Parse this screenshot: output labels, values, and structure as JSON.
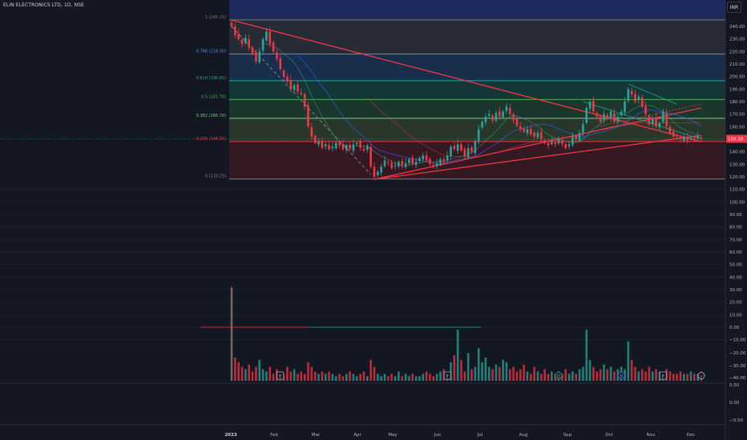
{
  "title": "ELIN ELECTRONICS LTD, 1D, NSE",
  "currency_button": "INR",
  "chart_data": {
    "type": "candlestick",
    "symbol": "ELIN ELECTRONICS LTD",
    "interval": "1D",
    "exchange": "NSE",
    "price_axis": {
      "range": [
        -10,
        250
      ],
      "ticks": [
        240,
        230,
        220,
        210,
        200,
        190,
        180,
        170,
        160,
        150,
        140,
        130,
        120,
        110,
        100,
        90,
        80,
        70,
        60,
        50,
        40,
        30,
        20,
        10,
        0,
        -10
      ],
      "tick_labels": [
        "240.00",
        "230.00",
        "220.00",
        "210.00",
        "200.00",
        "190.00",
        "180.00",
        "170.00",
        "160.00",
        "150.00",
        "140.00",
        "130.00",
        "120.00",
        "110.00",
        "100.00",
        "90.00",
        "80.00",
        "70.00",
        "60.00",
        "50.00",
        "40.00",
        "30.00",
        "20.00",
        "10.00",
        "0.00",
        "−10.00"
      ],
      "current_price": 150.3,
      "current_price_label": "150.30"
    },
    "oscillator_axis": {
      "ticks": [
        -20,
        -30,
        -40
      ],
      "tick_labels": [
        "−20.00",
        "−30.00",
        "−40.00"
      ]
    },
    "bottom_pane_axis": {
      "tick_labels": [
        "0.50",
        "0.00",
        "−0.50"
      ]
    },
    "x_axis": {
      "labels": [
        "2023",
        "Feb",
        "Mar",
        "Apr",
        "May",
        "Jun",
        "Jul",
        "Aug",
        "Sep",
        "Oct",
        "Nov",
        "Dec"
      ],
      "bold_label": "2023"
    },
    "fibonacci": {
      "levels": [
        {
          "ratio": "1",
          "price": 245.15,
          "label": "1 (245.15)",
          "color": "#787b86"
        },
        {
          "ratio": "0.786",
          "price": 218.0,
          "label": "0.786 (218.00)",
          "color": "#4c8fe8"
        },
        {
          "ratio": "0.618",
          "price": 196.65,
          "label": "0.618 (196.65)",
          "color": "#26a69a"
        },
        {
          "ratio": "0.5",
          "price": 181.7,
          "label": "0.5 (181.70)",
          "color": "#4caf50"
        },
        {
          "ratio": "0.382",
          "price": 166.7,
          "label": "0.382 (166.70)",
          "color": "#81c784"
        },
        {
          "ratio": "0.236",
          "price": 148.2,
          "label": "0.236 (148.20)",
          "color": "#f23645"
        },
        {
          "ratio": "0",
          "price": 118.25,
          "label": "0 (118.25)",
          "color": "#787b86"
        }
      ],
      "band_colors": [
        "#1e2a5c",
        "#2a2e39",
        "#1b3150",
        "#163a3a",
        "#1d3a2e",
        "#2b3b2a",
        "#3a1a22"
      ]
    },
    "series": [
      {
        "name": "",
        "type": "candlestick",
        "closes": [
          [
            0,
            240
          ],
          [
            1,
            233
          ],
          [
            2,
            230
          ],
          [
            3,
            226
          ],
          [
            4,
            231
          ],
          [
            5,
            223
          ],
          [
            6,
            218
          ],
          [
            7,
            212
          ],
          [
            8,
            220
          ],
          [
            9,
            230
          ],
          [
            10,
            236
          ],
          [
            11,
            226
          ],
          [
            12,
            220
          ],
          [
            13,
            214
          ],
          [
            14,
            206
          ],
          [
            15,
            200
          ],
          [
            16,
            196
          ],
          [
            17,
            190
          ],
          [
            18,
            193
          ],
          [
            19,
            188
          ],
          [
            20,
            186
          ],
          [
            21,
            176
          ],
          [
            22,
            160
          ],
          [
            23,
            152
          ],
          [
            24,
            147
          ],
          [
            25,
            148
          ],
          [
            26,
            143
          ],
          [
            27,
            146
          ],
          [
            28,
            142
          ],
          [
            29,
            144
          ],
          [
            30,
            147
          ],
          [
            31,
            145
          ],
          [
            32,
            142
          ],
          [
            33,
            145
          ],
          [
            34,
            142
          ],
          [
            35,
            146
          ],
          [
            36,
            147
          ],
          [
            37,
            143
          ],
          [
            38,
            141
          ],
          [
            39,
            145
          ],
          [
            40,
            128
          ],
          [
            41,
            120
          ],
          [
            42,
            124
          ],
          [
            43,
            128
          ],
          [
            44,
            133
          ],
          [
            45,
            131
          ],
          [
            46,
            127
          ],
          [
            47,
            129
          ],
          [
            48,
            132
          ],
          [
            49,
            129
          ],
          [
            50,
            131
          ],
          [
            51,
            134
          ],
          [
            52,
            130
          ],
          [
            53,
            132
          ],
          [
            54,
            135
          ],
          [
            55,
            137
          ],
          [
            56,
            133
          ],
          [
            57,
            130
          ],
          [
            58,
            128
          ],
          [
            59,
            131
          ],
          [
            60,
            134
          ],
          [
            61,
            132
          ],
          [
            62,
            137
          ],
          [
            63,
            144
          ],
          [
            64,
            142
          ],
          [
            65,
            146
          ],
          [
            66,
            141
          ],
          [
            67,
            136
          ],
          [
            68,
            143
          ],
          [
            69,
            140
          ],
          [
            70,
            148
          ],
          [
            71,
            158
          ],
          [
            72,
            164
          ],
          [
            73,
            168
          ],
          [
            74,
            170
          ],
          [
            75,
            165
          ],
          [
            76,
            171
          ],
          [
            77,
            168
          ],
          [
            78,
            172
          ],
          [
            79,
            176
          ],
          [
            80,
            170
          ],
          [
            81,
            165
          ],
          [
            82,
            161
          ],
          [
            83,
            158
          ],
          [
            84,
            156
          ],
          [
            85,
            158
          ],
          [
            86,
            154
          ],
          [
            87,
            152
          ],
          [
            88,
            155
          ],
          [
            89,
            150
          ],
          [
            90,
            147
          ],
          [
            91,
            145
          ],
          [
            92,
            148
          ],
          [
            93,
            146
          ],
          [
            94,
            150
          ],
          [
            95,
            146
          ],
          [
            96,
            143
          ],
          [
            97,
            146
          ],
          [
            98,
            152
          ],
          [
            99,
            150
          ],
          [
            100,
            155
          ],
          [
            101,
            162
          ],
          [
            102,
            175
          ],
          [
            103,
            180
          ],
          [
            104,
            172
          ],
          [
            105,
            168
          ],
          [
            106,
            164
          ],
          [
            107,
            170
          ],
          [
            108,
            166
          ],
          [
            109,
            172
          ],
          [
            110,
            164
          ],
          [
            111,
            168
          ],
          [
            112,
            172
          ],
          [
            113,
            180
          ],
          [
            114,
            190
          ],
          [
            115,
            186
          ],
          [
            116,
            180
          ],
          [
            117,
            184
          ],
          [
            118,
            176
          ],
          [
            119,
            170
          ],
          [
            120,
            162
          ],
          [
            121,
            166
          ],
          [
            122,
            160
          ],
          [
            123,
            163
          ],
          [
            124,
            172
          ],
          [
            125,
            160
          ],
          [
            126,
            155
          ],
          [
            127,
            152
          ],
          [
            128,
            151
          ],
          [
            129,
            150
          ],
          [
            130,
            152
          ],
          [
            131,
            149
          ],
          [
            132,
            151
          ],
          [
            133,
            150
          ],
          [
            134,
            152
          ],
          [
            135,
            150.3
          ]
        ]
      }
    ],
    "volume": [
      40,
      10,
      8,
      6,
      5,
      7,
      4,
      6,
      9,
      5,
      4,
      6,
      3,
      5,
      4,
      3,
      6,
      4,
      5,
      3,
      4,
      3,
      8,
      6,
      4,
      3,
      4,
      3,
      4,
      3,
      2,
      3,
      2,
      3,
      4,
      3,
      2,
      3,
      4,
      2,
      9,
      6,
      3,
      2,
      3,
      2,
      3,
      2,
      4,
      2,
      3,
      2,
      3,
      2,
      2,
      3,
      4,
      3,
      2,
      3,
      4,
      5,
      3,
      8,
      11,
      22,
      9,
      4,
      12,
      5,
      6,
      14,
      8,
      10,
      6,
      5,
      7,
      6,
      9,
      8,
      5,
      6,
      4,
      5,
      7,
      4,
      3,
      6,
      4,
      3,
      5,
      3,
      4,
      3,
      4,
      3,
      5,
      3,
      4,
      3,
      5,
      6,
      22,
      9,
      6,
      4,
      5,
      7,
      5,
      6,
      4,
      5,
      6,
      5,
      17,
      9,
      6,
      4,
      5,
      4,
      6,
      4,
      5,
      4,
      3,
      5,
      4,
      3,
      3,
      4,
      3,
      3,
      4,
      3,
      3,
      4
    ],
    "event_markers": [
      {
        "label": "E",
        "index": 14
      },
      {
        "label": "E",
        "index": 62
      },
      {
        "label": "D",
        "index": 94
      },
      {
        "label": "D",
        "index": 112
      },
      {
        "label": "E",
        "index": 124
      }
    ],
    "flash_icon": "lightning-icon"
  }
}
